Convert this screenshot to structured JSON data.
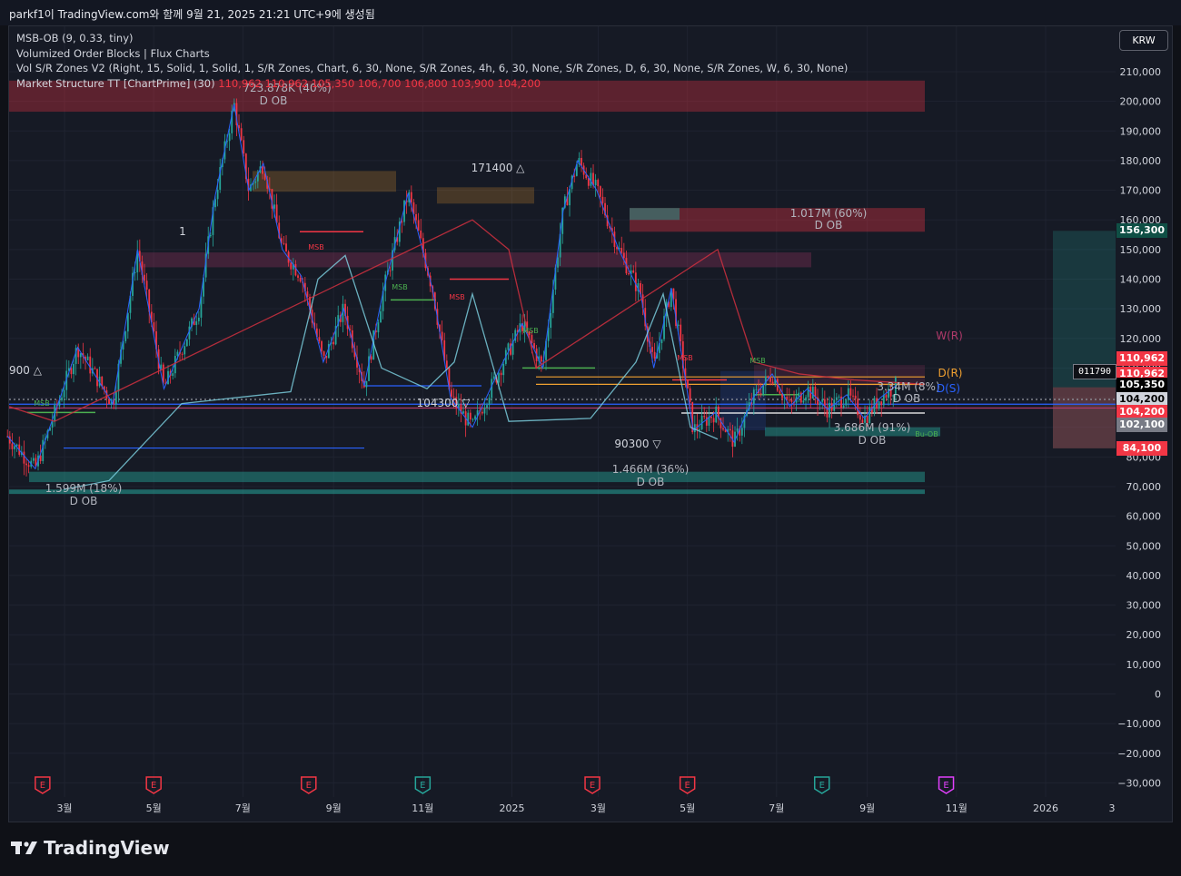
{
  "header": {
    "title": "parkf1이 TradingView.com와 함께 9월 21, 2025 21:21 UTC+9에 생성됨"
  },
  "legend": {
    "indicators": [
      "MSB-OB (9, 0.33, tiny)",
      "Volumized Order Blocks | Flux Charts",
      "Vol S/R Zones V2 (Right, 15, Solid, 1, Solid, 1, S/R Zones, Chart, 6, 30, None, S/R Zones, 4h, 6, 30, None, S/R Zones, D, 6, 30, None, S/R Zones, W, 6, 30, None)"
    ],
    "ms_name": "Market Structure TT [ChartPrime] (30)",
    "ms_values": "110,962  110,962  105,350  106,700  106,800  103,900  104,200"
  },
  "currency_button": "KRW",
  "colors": {
    "bull": "#26a69a",
    "bear": "#f23645",
    "bg": "#161a25",
    "grid": "#1f2330",
    "axis_text": "#d1d4dc"
  },
  "price_labels": [
    {
      "text": "156,300",
      "value": 156300,
      "bg": "#0f4f45",
      "fg": "#ffffff"
    },
    {
      "text": "110,962",
      "value": 113200,
      "bg": "#f23645",
      "fg": "#ffffff"
    },
    {
      "text": "110,962",
      "value": 108100,
      "bg": "#f23645",
      "fg": "#ffffff"
    },
    {
      "text": "105,350",
      "value": 104300,
      "bg": "#000000",
      "fg": "#ffffff"
    },
    {
      "text": "104,200",
      "value": 99400,
      "bg": "#d1d4dc",
      "fg": "#000000"
    },
    {
      "text": "104,200",
      "value": 95200,
      "bg": "#f23645",
      "fg": "#ffffff"
    },
    {
      "text": "102,100",
      "value": 90800,
      "bg": "#787b86",
      "fg": "#ffffff"
    },
    {
      "text": "84,100",
      "value": 82900,
      "bg": "#f23645",
      "fg": "#ffffff"
    }
  ],
  "countdown": "011790",
  "chart_annotations": [
    {
      "text": "723.878K (40%)",
      "color": "#b2b5be"
    },
    {
      "text": "D OB",
      "color": "#b2b5be"
    },
    {
      "text": "1.017M (60%)",
      "color": "#b2b5be"
    },
    {
      "text": "D OB",
      "color": "#b2b5be"
    },
    {
      "text": "171400 △",
      "color": "#d1d4dc"
    },
    {
      "text": "104300 ▽",
      "color": "#d1d4dc"
    },
    {
      "text": "90300 ▽",
      "color": "#d1d4dc"
    },
    {
      "text": "900 △",
      "color": "#d1d4dc"
    },
    {
      "text": "1",
      "color": "#d1d4dc"
    },
    {
      "text": "1.466M (36%)",
      "color": "#b2b5be"
    },
    {
      "text": "D OB",
      "color": "#b2b5be"
    },
    {
      "text": "1.599M (18%)",
      "color": "#b2b5be"
    },
    {
      "text": "D OB",
      "color": "#b2b5be"
    },
    {
      "text": "3.686M (91%)",
      "color": "#b2b5be"
    },
    {
      "text": "D OB",
      "color": "#b2b5be"
    },
    {
      "text": "3.34M (8%)",
      "color": "#b2b5be"
    },
    {
      "text": "D OB",
      "color": "#b2b5be"
    },
    {
      "text": "W(R)",
      "color": "#b03a6a"
    },
    {
      "text": "D(R)",
      "color": "#f0a030"
    },
    {
      "text": "D(S)",
      "color": "#2962ff"
    },
    {
      "text": "MSB",
      "color": "#f23645"
    },
    {
      "text": "MSB",
      "color": "#f23645"
    },
    {
      "text": "MSB",
      "color": "#f23645"
    },
    {
      "text": "MSB",
      "color": "#4caf50"
    },
    {
      "text": "MSB",
      "color": "#4caf50"
    },
    {
      "text": "MSB",
      "color": "#4caf50"
    },
    {
      "text": "MSB",
      "color": "#4caf50"
    },
    {
      "text": "Bu-OB",
      "color": "#4caf50"
    }
  ],
  "earnings_markers": [
    {
      "text": "E",
      "color": "#f23645"
    },
    {
      "text": "E",
      "color": "#f23645"
    },
    {
      "text": "E",
      "color": "#f23645"
    },
    {
      "text": "E",
      "color": "#26a69a"
    },
    {
      "text": "E",
      "color": "#f23645"
    },
    {
      "text": "E",
      "color": "#f23645"
    },
    {
      "text": "E",
      "color": "#26a69a"
    },
    {
      "text": "E",
      "color": "#e040fb"
    }
  ],
  "footer": {
    "brand": "TradingView"
  },
  "chart_data": {
    "type": "candlestick",
    "ylim": [
      -35000,
      220000
    ],
    "ytick_labels": [
      "210,000",
      "200,000",
      "190,000",
      "180,000",
      "170,000",
      "160,000",
      "150,000",
      "140,000",
      "130,000",
      "120,000",
      "110,000",
      "100,000",
      "90,000",
      "80,000",
      "70,000",
      "60,000",
      "50,000",
      "40,000",
      "30,000",
      "20,000",
      "10,000",
      "0",
      "−10,000",
      "−20,000",
      "−30,000"
    ],
    "ytick_values": [
      210000,
      200000,
      190000,
      180000,
      170000,
      160000,
      150000,
      140000,
      130000,
      120000,
      110000,
      100000,
      90000,
      80000,
      70000,
      60000,
      50000,
      40000,
      30000,
      20000,
      10000,
      0,
      -10000,
      -20000,
      -30000
    ],
    "xtick_labels": [
      "3월",
      "5월",
      "7월",
      "9월",
      "11월",
      "2025",
      "3월",
      "5월",
      "7월",
      "9월",
      "11월",
      "2026",
      "3"
    ],
    "xtick_dates": [
      "2024-03-01",
      "2024-05-01",
      "2024-07-01",
      "2024-09-01",
      "2024-11-01",
      "2025-01-01",
      "2025-03-01",
      "2025-05-01",
      "2025-07-01",
      "2025-09-01",
      "2025-11-01",
      "2026-01-01",
      "2026-03-01"
    ],
    "price_path_dates": [
      "2024-01-22",
      "2024-02-10",
      "2024-03-10",
      "2024-04-03",
      "2024-04-20",
      "2024-05-08",
      "2024-06-01",
      "2024-06-12",
      "2024-06-25",
      "2024-07-05",
      "2024-07-15",
      "2024-07-28",
      "2024-08-10",
      "2024-08-25",
      "2024-09-08",
      "2024-09-22",
      "2024-10-05",
      "2024-10-22",
      "2024-11-08",
      "2024-11-20",
      "2024-12-05",
      "2024-12-22",
      "2025-01-08",
      "2025-01-22",
      "2025-02-05",
      "2025-02-15",
      "2025-02-28",
      "2025-03-15",
      "2025-03-30",
      "2025-04-08",
      "2025-04-20",
      "2025-05-05",
      "2025-05-20",
      "2025-06-02",
      "2025-06-15",
      "2025-06-28",
      "2025-07-10",
      "2025-07-22",
      "2025-08-05",
      "2025-08-18",
      "2025-08-30",
      "2025-09-10",
      "2025-09-21"
    ],
    "price_path_values": [
      87000,
      76000,
      117000,
      98000,
      150000,
      103000,
      130000,
      168000,
      199000,
      170000,
      179000,
      150000,
      141000,
      112000,
      130000,
      104000,
      136000,
      169000,
      136000,
      100000,
      90000,
      108000,
      125000,
      110000,
      163000,
      180000,
      170000,
      150000,
      135000,
      110000,
      137000,
      89000,
      95000,
      85000,
      100000,
      108000,
      97000,
      103000,
      96000,
      101000,
      93000,
      100000,
      104200
    ]
  }
}
